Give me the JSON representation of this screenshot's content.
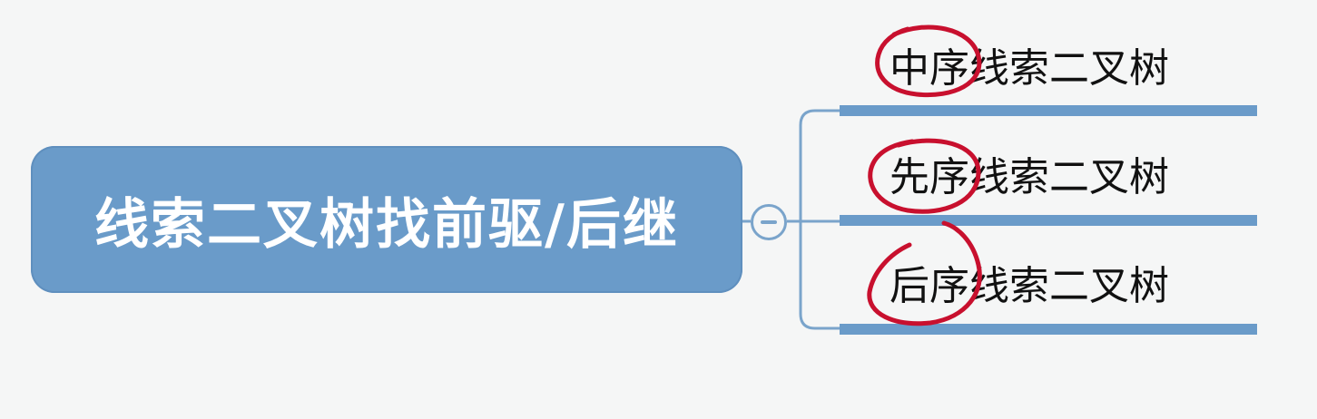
{
  "root": {
    "label": "线索二叉树找前驱/后继"
  },
  "collapse_button": {
    "symbol": "minus"
  },
  "children": [
    {
      "label": "中序线索二叉树"
    },
    {
      "label": "先序线索二叉树"
    },
    {
      "label": "后序线索二叉树"
    }
  ],
  "colors": {
    "node_fill": "#6a9bc9",
    "connector": "#7aa4cb",
    "annotation": "#c8102e",
    "background": "#f5f6f6"
  }
}
